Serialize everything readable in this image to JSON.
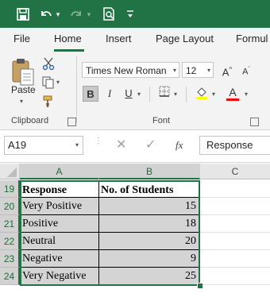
{
  "titlebar": {
    "save_icon": "save-icon",
    "undo_icon": "undo-icon",
    "redo_icon": "redo-icon",
    "print_preview_icon": "print-preview-icon",
    "customize_icon": "customize-qat-icon",
    "bg_color": "#217346"
  },
  "ribbon_tabs": [
    "File",
    "Home",
    "Insert",
    "Page Layout",
    "Formul"
  ],
  "active_tab": "Home",
  "clipboard": {
    "paste_label": "Paste",
    "group_label": "Clipboard"
  },
  "font": {
    "font_name": "Times New Roman",
    "font_size": "12",
    "bold_label": "B",
    "italic_label": "I",
    "underline_label": "U",
    "grow_label": "A",
    "shrink_label": "A",
    "font_color_label": "A",
    "group_label": "Font",
    "highlight_color": "#ffff00",
    "font_color": "#ff0000"
  },
  "formula_bar": {
    "name_box": "A19",
    "fx_label": "fx",
    "formula_value": "Response"
  },
  "sheet": {
    "columns": [
      "A",
      "B",
      "C"
    ],
    "rows": [
      {
        "num": "19",
        "a": "Response",
        "b": "No. of Students"
      },
      {
        "num": "20",
        "a": "Very Positive",
        "b": "15"
      },
      {
        "num": "21",
        "a": "Positive",
        "b": "18"
      },
      {
        "num": "22",
        "a": "Neutral",
        "b": "20"
      },
      {
        "num": "23",
        "a": "Negative",
        "b": "9"
      },
      {
        "num": "24",
        "a": "Very Negative",
        "b": "25"
      }
    ]
  }
}
